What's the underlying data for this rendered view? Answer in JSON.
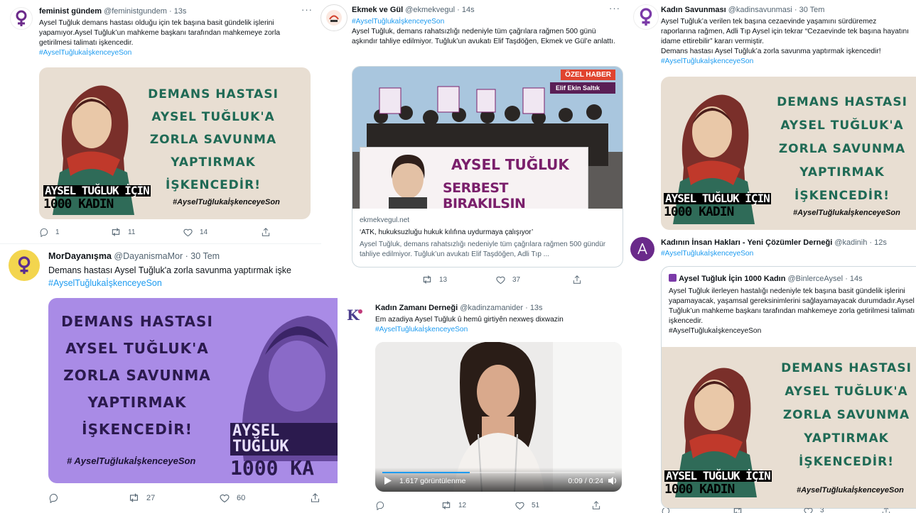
{
  "tweets": {
    "t1": {
      "name": "feminist gündem",
      "handle": "@feministgundem",
      "time": "· 13s",
      "text": "Aysel Tuğluk demans hastası olduğu için tek başına basit gündelik işlerini yapamıyor.Aysel Tuğluk’un mahkeme başkanı tarafından mahkemeye zorla getirilmesi talimatı işkencedir.",
      "hashtag": "#AyselTuğlukaİşkenceyeSon",
      "counts": {
        "reply": "1",
        "retweet": "11",
        "like": "14"
      }
    },
    "t2": {
      "name": "Ekmek ve Gül",
      "handle": "@ekmekvegul",
      "time": "· 14s",
      "hashtag": "#AyselTuğlukaİşkenceyeSon",
      "text": "Aysel Tuğluk, demans rahatsızlığı nedeniyle tüm çağrılara rağmen 500 günü aşkındır tahliye edilmiyor. Tuğluk’un avukatı Elif Taşdöğen, Ekmek ve Gül’e anlattı.",
      "photo": {
        "badge": "ÖZEL HABER",
        "byline": "Elif Ekin Saltık",
        "banner_line1": "AYSEL TUĞLUK",
        "banner_line2": "SERBEST BIRAKILSIN"
      },
      "link": {
        "domain": "ekmekvegul.net",
        "title": "‘ATK, hukuksuzluğu hukuk kılıfına uydurmaya çalışıyor’",
        "desc": "Aysel Tuğluk, demans rahatsızlığı nedeniyle tüm çağrılara rağmen 500 gündür tahliye edilmiyor. Tuğluk’un avukatı Elif Taşdöğen, Adli Tıp ..."
      },
      "counts": {
        "retweet": "13",
        "like": "37"
      }
    },
    "t3": {
      "name": "Kadın Savunması",
      "handle": "@kadinsavunmasi",
      "time": "· 30 Tem",
      "text": "Aysel Tuğluk’a verilen tek başına cezaevinde yaşamını sürdüremez raporlarına rağmen, Adli Tıp Aysel için tekrar “Cezaevinde tek başına hayatını idame ettirebilir” kararı vermiştir.",
      "text2": "Demans hastası Aysel Tuğluk’a zorla savunma yaptırmak işkencedir!",
      "hashtag": "#AyselTuğlukaİşkenceyeSon"
    },
    "t4": {
      "name": "MorDayanışma",
      "handle": "@DayanismaMor",
      "time": "· 30 Tem",
      "text": "Demans hastası Aysel Tuğluk'a zorla savunma yaptırmak işke",
      "hashtag": "#AyselTuğlukaİşkenceyeSon",
      "counts": {
        "retweet": "27",
        "like": "60"
      }
    },
    "t5": {
      "name": "Kadın Zamanı Derneği",
      "handle": "@kadinzamanider",
      "time": "· 13s",
      "text": "Em azadiya Aysel Tuğluk û hemû girtiyên nexweş dixwazin",
      "hashtag": "#AyselTuğlukaİşkenceyeSon",
      "video": {
        "views": "1.617 görüntülenme",
        "duration": "0:09 / 0:24"
      },
      "counts": {
        "retweet": "12",
        "like": "51"
      }
    },
    "t6": {
      "name": "Kadının İnsan Hakları - Yeni Çözümler Derneği",
      "handle": "@kadinih",
      "time": "· 12s",
      "hashtag": "#AyselTuğlukaİşkenceyeSon",
      "quote": {
        "name": "Aysel Tuğluk İçin 1000 Kadın",
        "handle": "@BinlerceAysel",
        "time": "· 14s",
        "text": "Aysel Tuğluk ilerleyen hastalığı nedeniyle tek başına basit gündelik işlerini yapamayacak, yaşamsal gereksinimlerini sağlayamayacak durumdadır.Aysel Tuğluk’un mahkeme başkanı tarafından mahkemeye zorla getirilmesi talimatı işkencedir.",
        "hashtag": "#AyselTuğlukaİşkenceyeSon"
      },
      "counts": {
        "reply_partial": "",
        "like_partial": "3"
      }
    }
  },
  "poster": {
    "line1": "DEMANS HASTASI",
    "line2": "AYSEL TUĞLUK'A",
    "line3": "ZORLA SAVUNMA",
    "line4": "YAPTIRMAK",
    "line5": "İŞKENCEDİR!",
    "name_line1": "AYSEL TUĞLUK İÇİN",
    "name_line2": "1000 KADIN",
    "name_line1_short": "AYSEL TUĞLUK",
    "name_line2_short": "1000 KA",
    "tag": "#AyselTuğlukaİşkenceyeSon",
    "tag_purple": "# AyselTuğlukaİşkenceyeSon"
  },
  "colors": {
    "link": "#1d9bf0",
    "poster_green": "#1f6a55",
    "poster_bg": "#e8ded2",
    "purple_bg": "#a98be6",
    "purple_text": "#2b1a4e",
    "banner_purple": "#7a1f6b"
  },
  "icons": [
    "venus-icon",
    "reply-icon",
    "retweet-icon",
    "like-icon",
    "share-icon",
    "more-icon",
    "play-icon",
    "volume-icon"
  ]
}
